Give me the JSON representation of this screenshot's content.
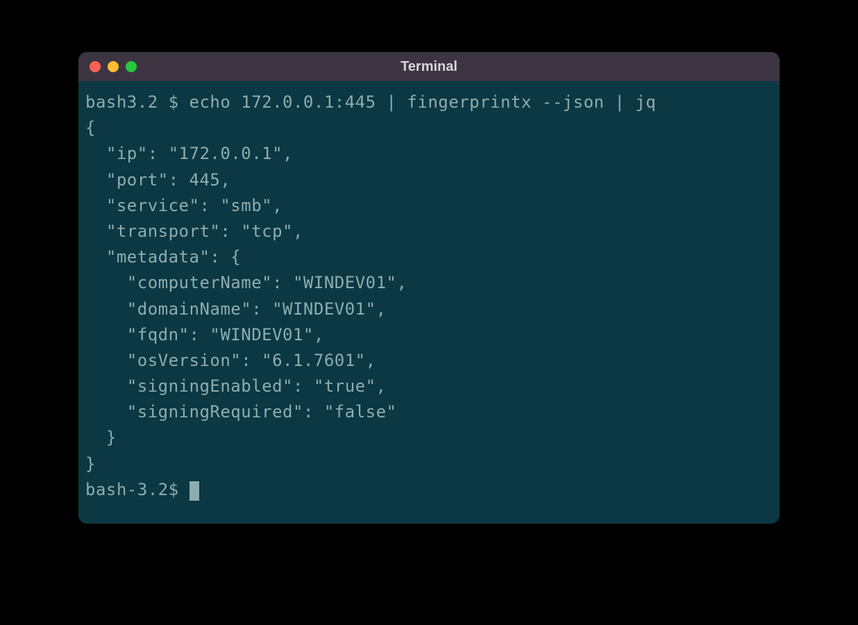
{
  "window": {
    "title": "Terminal"
  },
  "terminal": {
    "lines": [
      "bash3.2 $ echo 172.0.0.1:445 | fingerprintx --json | jq",
      "{",
      "  \"ip\": \"172.0.0.1\",",
      "  \"port\": 445,",
      "  \"service\": \"smb\",",
      "  \"transport\": \"tcp\",",
      "  \"metadata\": {",
      "    \"computerName\": \"WINDEV01\",",
      "    \"domainName\": \"WINDEV01\",",
      "    \"fqdn\": \"WINDEV01\",",
      "    \"osVersion\": \"6.1.7601\",",
      "    \"signingEnabled\": \"true\",",
      "    \"signingRequired\": \"false\"",
      "  }",
      "}"
    ],
    "prompt": "bash-3.2$ "
  }
}
